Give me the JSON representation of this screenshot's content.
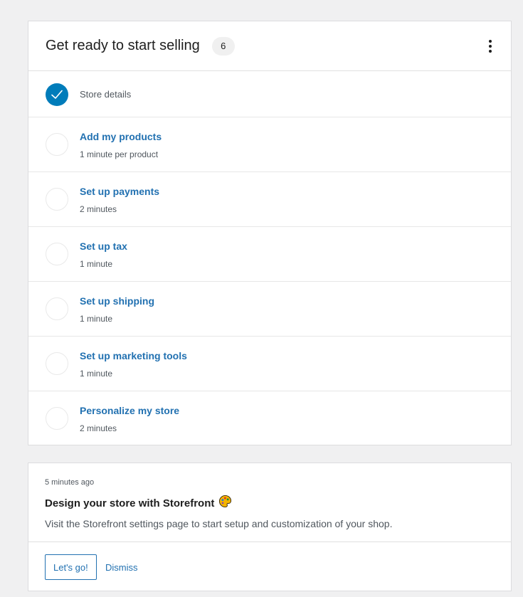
{
  "tasks_card": {
    "title": "Get ready to start selling",
    "count": "6",
    "tasks": [
      {
        "title": "Store details",
        "time": "",
        "completed": true
      },
      {
        "title": "Add my products",
        "time": "1 minute per product",
        "completed": false
      },
      {
        "title": "Set up payments",
        "time": "2 minutes",
        "completed": false
      },
      {
        "title": "Set up tax",
        "time": "1 minute",
        "completed": false
      },
      {
        "title": "Set up shipping",
        "time": "1 minute",
        "completed": false
      },
      {
        "title": "Set up marketing tools",
        "time": "1 minute",
        "completed": false
      },
      {
        "title": "Personalize my store",
        "time": "2 minutes",
        "completed": false
      }
    ]
  },
  "notice": {
    "timestamp": "5 minutes ago",
    "title": "Design your store with Storefront",
    "title_icon": "palette-icon",
    "body": "Visit the Storefront settings page to start setup and customization of your shop.",
    "primary_label": "Let's go!",
    "secondary_label": "Dismiss"
  },
  "colors": {
    "accent": "#007cba",
    "link": "#2271b1",
    "background": "#f0f0f1"
  }
}
